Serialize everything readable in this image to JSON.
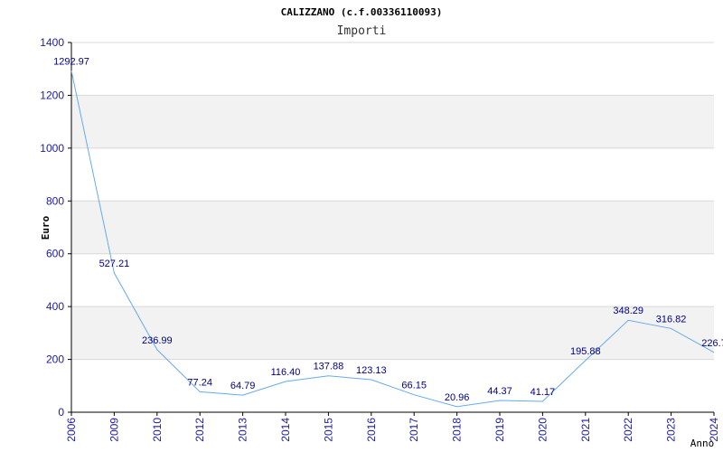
{
  "chart_data": {
    "type": "line",
    "title": "CALIZZANO (c.f.00336110093)",
    "subtitle": "Importi",
    "xlabel": "Anno",
    "ylabel": "Euro",
    "ylim": [
      0,
      1400
    ],
    "yticks": [
      0,
      200,
      400,
      600,
      800,
      1000,
      1200,
      1400
    ],
    "grid": true,
    "band_colors": [
      "#f2f2f2",
      "#ffffff"
    ],
    "line_color": "#66aaee",
    "categories": [
      "2006",
      "2009",
      "2010",
      "2012",
      "2013",
      "2014",
      "2015",
      "2016",
      "2017",
      "2018",
      "2019",
      "2020",
      "2021",
      "2022",
      "2023",
      "2024"
    ],
    "values": [
      1292.97,
      527.21,
      236.99,
      77.24,
      64.79,
      116.4,
      137.88,
      123.13,
      66.15,
      20.96,
      44.37,
      41.17,
      195.88,
      348.29,
      316.82,
      226.7
    ],
    "value_labels": [
      "1292.97",
      "527.21",
      "236.99",
      "77.24",
      "64.79",
      "116.40",
      "137.88",
      "123.13",
      "66.15",
      "20.96",
      "44.37",
      "41.17",
      "195.88",
      "348.29",
      "316.82",
      "226.7"
    ]
  }
}
